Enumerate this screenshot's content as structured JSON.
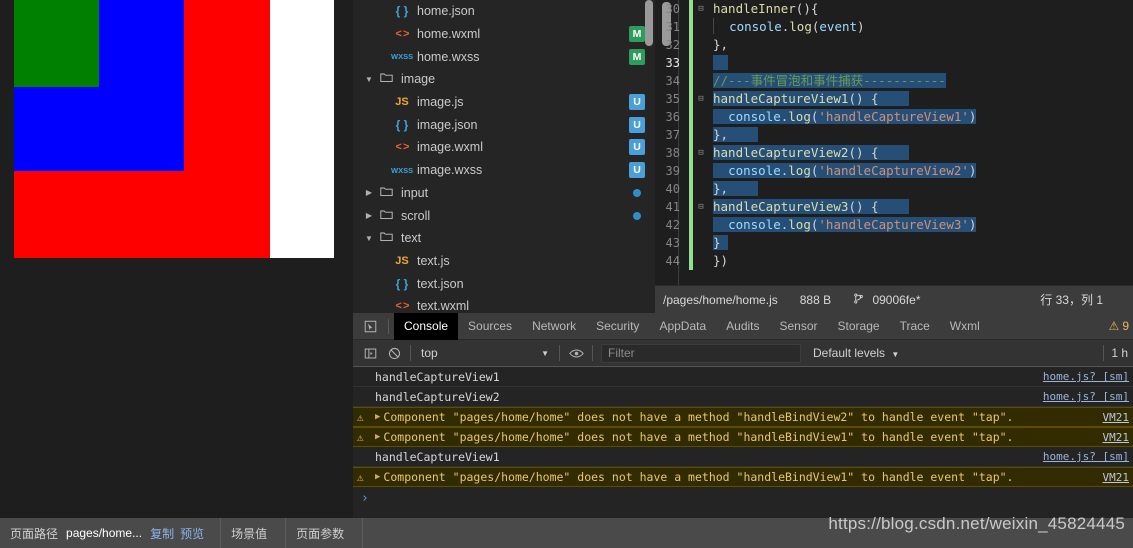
{
  "simulator": {
    "boxes": {
      "outer_color": "#ff0000",
      "middle_color": "#0000ff",
      "inner_color": "#008000",
      "page_background": "#ffffff"
    }
  },
  "filetree": {
    "rows": [
      {
        "twisty": "",
        "icon": "json",
        "icon_glyph": "{ }",
        "label": "home.json",
        "badge": "",
        "badge_type": "",
        "indent": 26
      },
      {
        "twisty": "",
        "icon": "wxml",
        "icon_glyph": "< >",
        "label": "home.wxml",
        "badge": "M",
        "badge_type": "m",
        "indent": 26
      },
      {
        "twisty": "",
        "icon": "wxss",
        "icon_glyph": "WXSS",
        "label": "home.wxss",
        "badge": "M",
        "badge_type": "m",
        "indent": 26
      },
      {
        "twisty": "▼",
        "icon": "folder",
        "icon_glyph": "🗀",
        "label": "image",
        "badge": "",
        "badge_type": "",
        "indent": 10
      },
      {
        "twisty": "",
        "icon": "js",
        "icon_glyph": "JS",
        "label": "image.js",
        "badge": "U",
        "badge_type": "u",
        "indent": 26
      },
      {
        "twisty": "",
        "icon": "json",
        "icon_glyph": "{ }",
        "label": "image.json",
        "badge": "U",
        "badge_type": "u",
        "indent": 26
      },
      {
        "twisty": "",
        "icon": "wxml",
        "icon_glyph": "< >",
        "label": "image.wxml",
        "badge": "U",
        "badge_type": "u",
        "indent": 26
      },
      {
        "twisty": "",
        "icon": "wxss",
        "icon_glyph": "WXSS",
        "label": "image.wxss",
        "badge": "U",
        "badge_type": "u",
        "indent": 26
      },
      {
        "twisty": "▶",
        "icon": "folder",
        "icon_glyph": "🗀",
        "label": "input",
        "badge": "dot",
        "badge_type": "dot",
        "indent": 10
      },
      {
        "twisty": "▶",
        "icon": "folder",
        "icon_glyph": "🗀",
        "label": "scroll",
        "badge": "dot",
        "badge_type": "dot",
        "indent": 10
      },
      {
        "twisty": "▼",
        "icon": "folder",
        "icon_glyph": "🗀",
        "label": "text",
        "badge": "",
        "badge_type": "",
        "indent": 10
      },
      {
        "twisty": "",
        "icon": "js",
        "icon_glyph": "JS",
        "label": "text.js",
        "badge": "",
        "badge_type": "",
        "indent": 26
      },
      {
        "twisty": "",
        "icon": "json",
        "icon_glyph": "{ }",
        "label": "text.json",
        "badge": "",
        "badge_type": "",
        "indent": 26
      },
      {
        "twisty": "",
        "icon": "wxml",
        "icon_glyph": "< >",
        "label": "text.wxml",
        "badge": "",
        "badge_type": "",
        "indent": 26
      }
    ]
  },
  "editor": {
    "lines": [
      {
        "num": "30",
        "fold": "−",
        "active": false,
        "html": "<span class=\"tok-fn\">handleInner</span><span class=\"tok-plain\">(){</span>"
      },
      {
        "num": "31",
        "fold": "",
        "active": false,
        "html": "<span class=\"indent-guide\"></span>  <span class=\"tok-prop\">console</span><span class=\"tok-plain\">.</span><span class=\"tok-fn\">log</span><span class=\"tok-plain\">(</span><span class=\"tok-prop\">event</span><span class=\"tok-plain\">)</span>"
      },
      {
        "num": "32",
        "fold": "",
        "active": false,
        "html": "<span class=\"tok-plain\">},</span>"
      },
      {
        "num": "33",
        "fold": "",
        "active": true,
        "html": "<span class=\"sel\">  </span>"
      },
      {
        "num": "34",
        "fold": "",
        "active": false,
        "html": "<span class=\"sel tok-com\">//---事件冒泡和事件捕获-----------</span>"
      },
      {
        "num": "35",
        "fold": "−",
        "active": false,
        "html": "<span class=\"sel\"><span class=\"tok-fn\">handleCaptureView1</span><span class=\"tok-plain\">() {    </span></span>"
      },
      {
        "num": "36",
        "fold": "",
        "active": false,
        "html": "<span class=\"sel\">  <span class=\"tok-prop\">console</span><span class=\"tok-plain\">.</span><span class=\"tok-fn\">log</span><span class=\"tok-plain\">(</span><span class=\"tok-str\">'handleCaptureView1'</span><span class=\"tok-plain\">)</span></span>"
      },
      {
        "num": "37",
        "fold": "",
        "active": false,
        "html": "<span class=\"sel\"><span class=\"tok-plain\">},    </span></span>"
      },
      {
        "num": "38",
        "fold": "−",
        "active": false,
        "html": "<span class=\"sel\"><span class=\"tok-fn\">handleCaptureView2</span><span class=\"tok-plain\">() {    </span></span>"
      },
      {
        "num": "39",
        "fold": "",
        "active": false,
        "html": "<span class=\"sel\">  <span class=\"tok-prop\">console</span><span class=\"tok-plain\">.</span><span class=\"tok-fn\">log</span><span class=\"tok-plain\">(</span><span class=\"tok-str\">'handleCaptureView2'</span><span class=\"tok-plain\">)</span></span>"
      },
      {
        "num": "40",
        "fold": "",
        "active": false,
        "html": "<span class=\"sel\"><span class=\"tok-plain\">},    </span></span>"
      },
      {
        "num": "41",
        "fold": "−",
        "active": false,
        "html": "<span class=\"sel\"><span class=\"tok-fn\">handleCaptureView3</span><span class=\"tok-plain\">() {    </span></span>"
      },
      {
        "num": "42",
        "fold": "",
        "active": false,
        "html": "<span class=\"sel\">  <span class=\"tok-prop\">console</span><span class=\"tok-plain\">.</span><span class=\"tok-fn\">log</span><span class=\"tok-plain\">(</span><span class=\"tok-str\">'handleCaptureView3'</span><span class=\"tok-plain\">)</span></span>"
      },
      {
        "num": "43",
        "fold": "",
        "active": false,
        "html": "<span class=\"sel\"><span class=\"tok-plain\">} </span></span>"
      },
      {
        "num": "44",
        "fold": "",
        "active": false,
        "html": "<span class=\"tok-plain\">})</span>"
      }
    ]
  },
  "editor_status": {
    "file_path": "/pages/home/home.js",
    "file_size": "888 B",
    "branch": "09006fe*",
    "cursor": "行 33，列 1"
  },
  "devtools": {
    "tabs": [
      {
        "label": "Console",
        "active": true
      },
      {
        "label": "Sources",
        "active": false
      },
      {
        "label": "Network",
        "active": false
      },
      {
        "label": "Security",
        "active": false
      },
      {
        "label": "AppData",
        "active": false
      },
      {
        "label": "Audits",
        "active": false
      },
      {
        "label": "Sensor",
        "active": false
      },
      {
        "label": "Storage",
        "active": false
      },
      {
        "label": "Trace",
        "active": false
      },
      {
        "label": "Wxml",
        "active": false
      }
    ],
    "warning_count": "9",
    "toolbar": {
      "context": "top",
      "filter_placeholder": "Filter",
      "levels": "Default levels",
      "right_info": "1 h"
    },
    "messages": [
      {
        "type": "log",
        "text": "handleCaptureView1",
        "source": "home.js? [sm]"
      },
      {
        "type": "log",
        "text": "handleCaptureView2",
        "source": "home.js? [sm]"
      },
      {
        "type": "warning",
        "text": "Component \"pages/home/home\" does not have a method \"handleBindView2\" to handle event \"tap\".",
        "source": "VM21"
      },
      {
        "type": "warning",
        "text": "Component \"pages/home/home\" does not have a method \"handleBindView1\" to handle event \"tap\".",
        "source": "VM21"
      },
      {
        "type": "log",
        "text": "handleCaptureView1",
        "source": "home.js? [sm]"
      },
      {
        "type": "warning",
        "text": "Component \"pages/home/home\" does not have a method \"handleBindView1\" to handle event \"tap\".",
        "source": "VM21"
      }
    ],
    "prompt": "›"
  },
  "bottombar": {
    "path_label": "页面路径",
    "path_value": "pages/home...",
    "copy_link": "复制",
    "preview_link": "预览",
    "scene_label": "场景值",
    "params_label": "页面参数"
  },
  "watermark": "https://blog.csdn.net/weixin_45824445"
}
